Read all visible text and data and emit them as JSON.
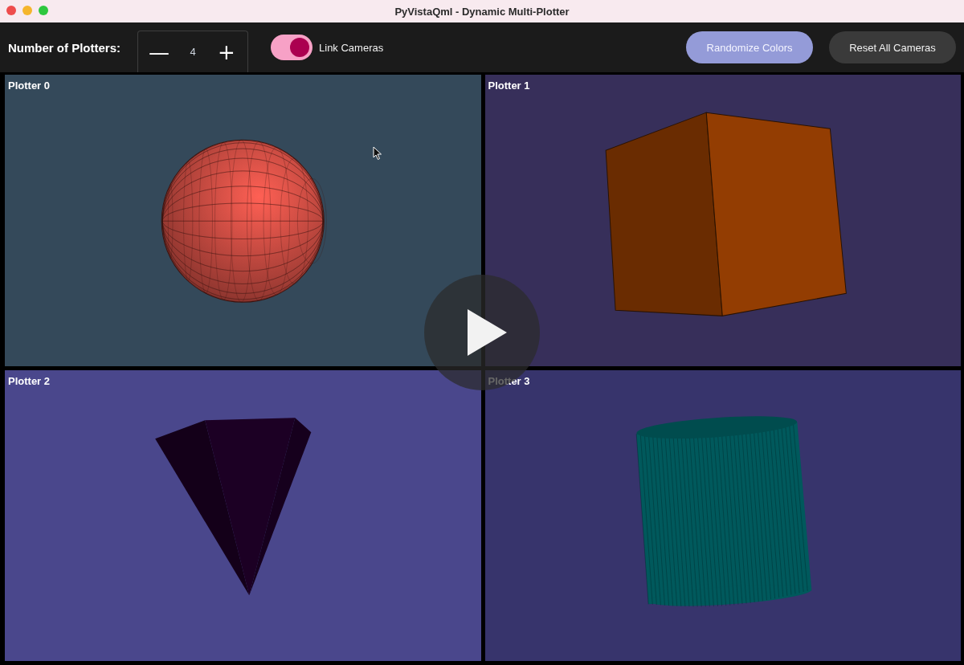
{
  "window": {
    "title": "PyVistaQml - Dynamic Multi-Plotter"
  },
  "toolbar": {
    "count_label": "Number of Plotters:",
    "stepper": {
      "decrement": "—",
      "value": "4",
      "increment": "+"
    },
    "link_cameras": {
      "label": "Link Cameras",
      "on": true
    },
    "buttons": [
      {
        "label": "Randomize Colors",
        "kind": "primary"
      },
      {
        "label": "Reset All Cameras",
        "kind": "secondary"
      }
    ]
  },
  "plotters": [
    {
      "title": "Plotter 0",
      "color": "#34495a",
      "mesh": {
        "kind": "sphere",
        "color": "#e8574c"
      }
    },
    {
      "title": "Plotter 1",
      "color": "#372f5a",
      "mesh": {
        "kind": "cube",
        "color": "#933d02"
      }
    },
    {
      "title": "Plotter 2",
      "color": "#4a478c",
      "mesh": {
        "kind": "cone",
        "color": "#1c0024"
      }
    },
    {
      "title": "Plotter 3",
      "color": "#37346c",
      "mesh": {
        "kind": "cylinder",
        "color": "#00595c"
      }
    }
  ]
}
